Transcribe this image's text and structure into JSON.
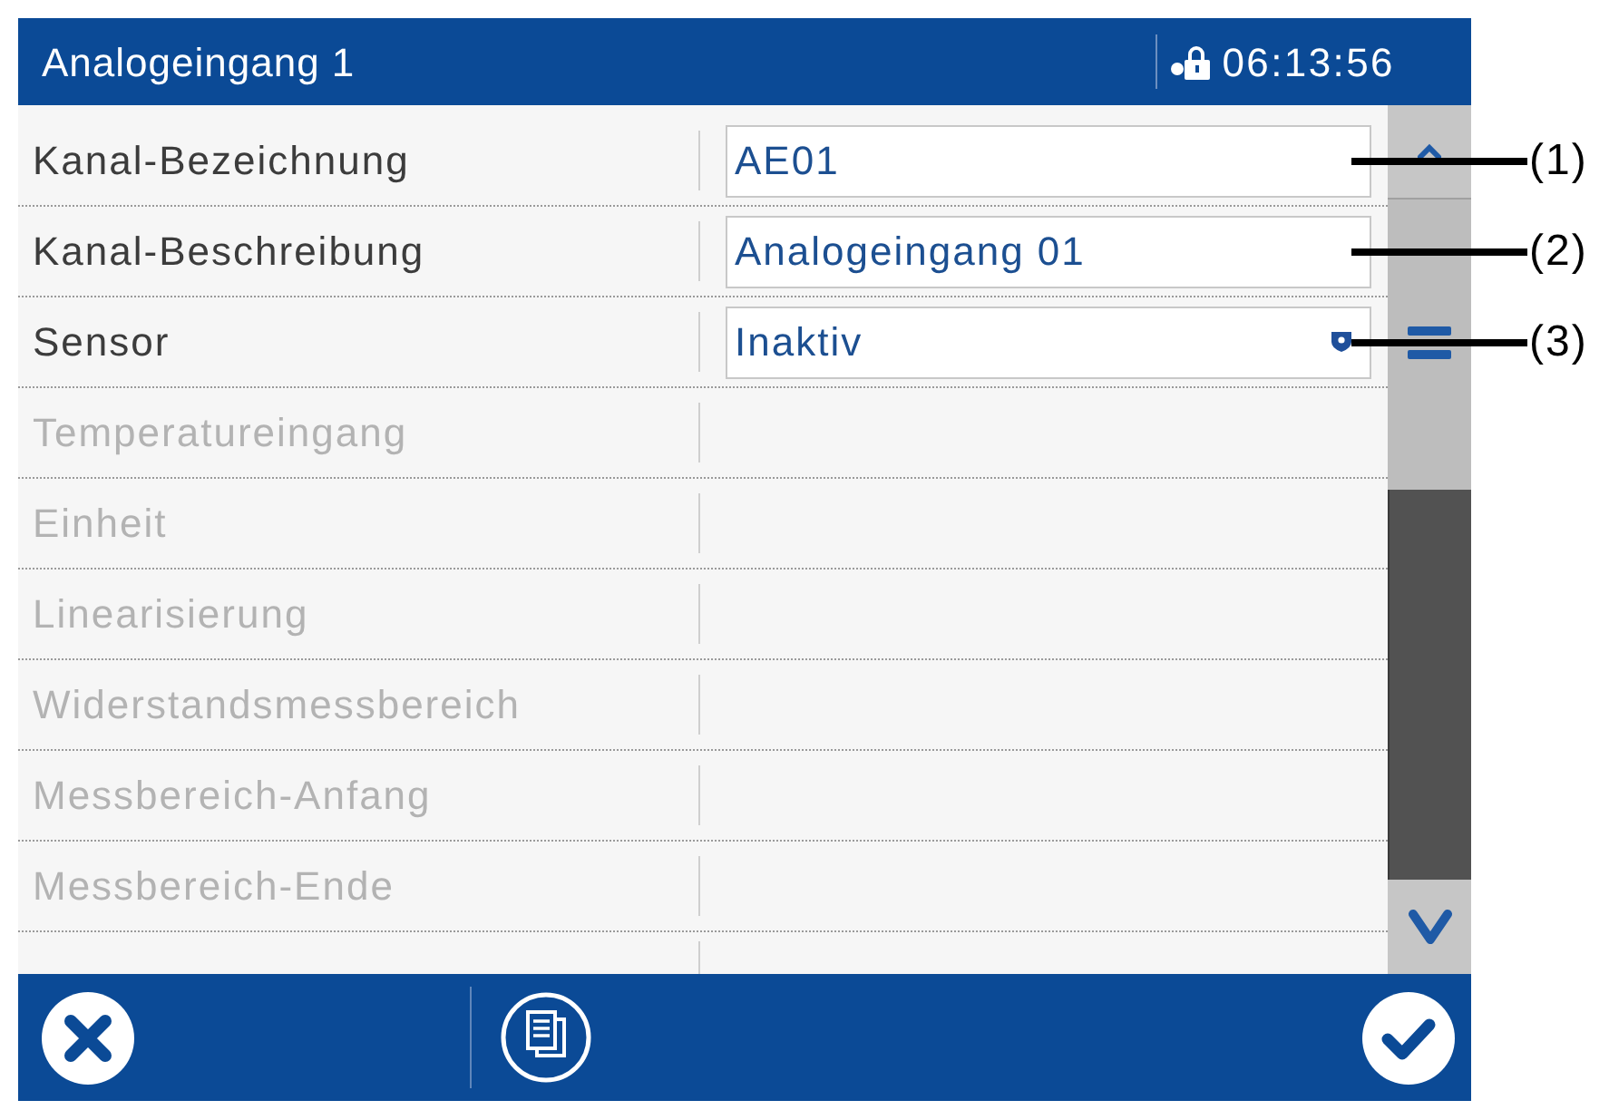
{
  "title_bar": {
    "title": "Analogeingang 1",
    "time": "06:13:56"
  },
  "rows": [
    {
      "label": "Kanal-Bezeichnung",
      "disabled": false,
      "field": {
        "kind": "text",
        "value": "AE01"
      }
    },
    {
      "label": "Kanal-Beschreibung",
      "disabled": false,
      "field": {
        "kind": "text",
        "value": "Analogeingang 01"
      }
    },
    {
      "label": "Sensor",
      "disabled": false,
      "field": {
        "kind": "dropdown",
        "value": "Inaktiv"
      }
    },
    {
      "label": "Temperatureingang",
      "disabled": true
    },
    {
      "label": "Einheit",
      "disabled": true
    },
    {
      "label": "Linearisierung",
      "disabled": true
    },
    {
      "label": "Widerstandsmessbereich",
      "disabled": true
    },
    {
      "label": "Messbereich-Anfang",
      "disabled": true
    },
    {
      "label": "Messbereich-Ende",
      "disabled": true
    }
  ],
  "callouts": [
    {
      "label": "(1)"
    },
    {
      "label": "(2)"
    },
    {
      "label": "(3)"
    }
  ]
}
